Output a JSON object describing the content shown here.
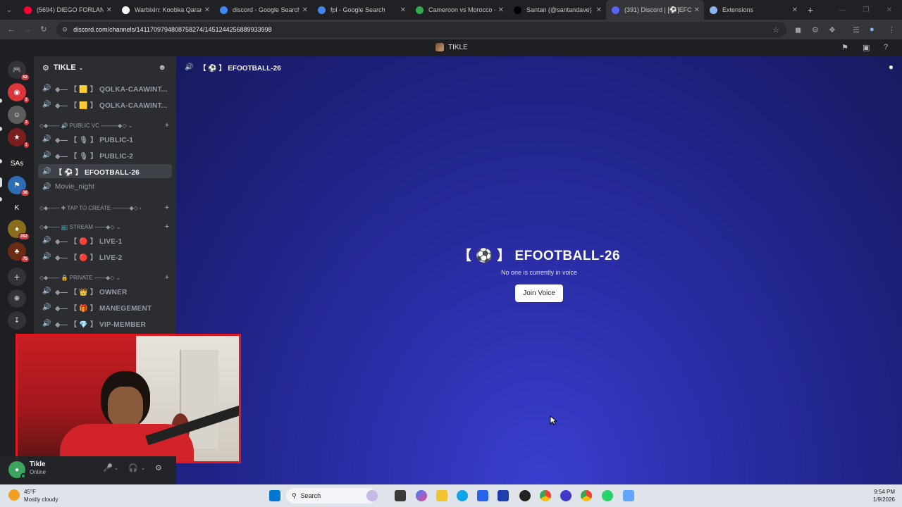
{
  "browser": {
    "tabs": [
      {
        "title": "(5694) DIEGO FORLAN ●",
        "color": "#ff0033"
      },
      {
        "title": "Warbixin: Koobka Qaram…",
        "color": "#ffffff"
      },
      {
        "title": "discord - Google Search",
        "color": "#4285f4"
      },
      {
        "title": "fpl - Google Search",
        "color": "#4285f4"
      },
      {
        "title": "Cameroon vs Morocco - I",
        "color": "#34a853"
      },
      {
        "title": "Santan (@santandave) O",
        "color": "#000000"
      },
      {
        "title": "(391) Discord | [⚽]EFO",
        "color": "#5865f2"
      },
      {
        "title": "Extensions",
        "color": "#8ab4f8"
      }
    ],
    "active_tab": 6,
    "url": "discord.com/channels/1411709794808758274/1451244256889933998"
  },
  "discord": {
    "guild_title": "TIKLE",
    "server_name": "TIKLE",
    "servers": [
      {
        "label": "🎮",
        "badge": "52",
        "color": "#313338"
      },
      {
        "label": "◉",
        "badge": "3",
        "color": "#da373c"
      },
      {
        "label": "☺",
        "badge": "3",
        "color": "#5c5c5c"
      },
      {
        "label": "★",
        "badge": "1",
        "color": "#7a1e1e"
      },
      {
        "label": "SAs",
        "badge": "",
        "color": "#1e1f22"
      },
      {
        "label": "⚑",
        "badge": "16",
        "color": "#2f6db5"
      },
      {
        "label": "K",
        "badge": "",
        "color": "#1e1f22"
      },
      {
        "label": "♠",
        "badge": "262",
        "color": "#8a6d1a"
      },
      {
        "label": "♣",
        "badge": "75",
        "color": "#6b2c14"
      }
    ],
    "channels": [
      {
        "kind": "voice",
        "name": "◆— 【 🟨 】 QOLKA-CAAWINT...",
        "active": false
      },
      {
        "kind": "voice",
        "name": "◆— 【 🟨 】 QOLKA-CAAWINT...",
        "active": false
      },
      {
        "kind": "category",
        "name": "◇◆—— 🔊 PUBLIC VC ———◆◇ ⌄"
      },
      {
        "kind": "voice",
        "name": "◆— 【 🎙 】 PUBLIC-1",
        "active": false
      },
      {
        "kind": "voice",
        "name": "◆— 【 🎙 】 PUBLIC-2",
        "active": false
      },
      {
        "kind": "voice",
        "name": "【 ⚽ 】 EFOOTBALL-26",
        "active": true
      },
      {
        "kind": "voice",
        "name": "Movie_night",
        "active": false,
        "plain": true
      },
      {
        "kind": "category",
        "name": "◇◆—— ✚ TAP TO CREATE ———◆◇ ›"
      },
      {
        "kind": "category",
        "name": "◇◆—— 📺 STREAM ——◆◇ ⌄"
      },
      {
        "kind": "voice",
        "name": "◆— 【 🔴 】 LIVE-1",
        "active": false
      },
      {
        "kind": "voice",
        "name": "◆— 【 🔴 】 LIVE-2",
        "active": false
      },
      {
        "kind": "category",
        "name": "◇◆—— 🔒 PRIVATE ——◆◇ ⌄"
      },
      {
        "kind": "voice",
        "name": "◆— 【 👑 】 OWNER",
        "active": false
      },
      {
        "kind": "voice",
        "name": "◆— 【 🎁 】 MANEGEMENT",
        "active": false
      },
      {
        "kind": "voice",
        "name": "◆— 【 💎 】 VIP-MEMBER",
        "active": false
      }
    ],
    "voice": {
      "header": "【 ⚽ 】 EFOOTBALL-26",
      "title": "【 ⚽ 】 EFOOTBALL-26",
      "subtitle": "No one is currently in voice",
      "join_label": "Join Voice"
    },
    "user": {
      "name": "Tikle",
      "status": "Online"
    }
  },
  "taskbar": {
    "weather_temp": "45°F",
    "weather_desc": "Mostly cloudy",
    "search_label": "Search",
    "time": "9:54 PM",
    "date": "1/9/2026"
  },
  "colors": {
    "discord_blurple": "#5865f2",
    "active_channel_bg": "#404249",
    "webcam_border": "#e3171f"
  }
}
